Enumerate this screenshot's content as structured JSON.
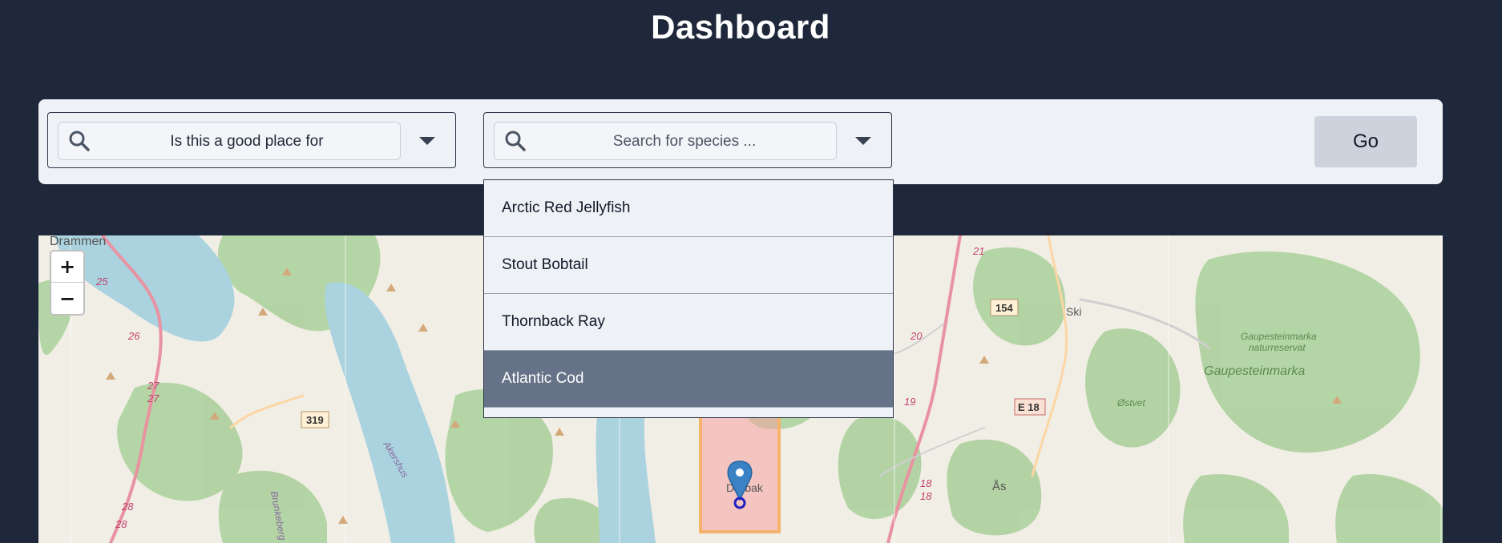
{
  "page": {
    "title": "Dashboard"
  },
  "toolbar": {
    "question_select": {
      "value": "Is this a good place for"
    },
    "species_select": {
      "placeholder": "Search for species ..."
    },
    "go_label": "Go"
  },
  "species_dropdown": {
    "options": [
      "Arctic Red Jellyfish",
      "Stout Bobtail",
      "Thornback Ray",
      "Atlantic Cod"
    ],
    "highlighted": "Atlantic Cod"
  },
  "map": {
    "zoom_in": "+",
    "zoom_out": "−",
    "labels": {
      "drammen": "Drammen",
      "ski": "Ski",
      "as": "Ås",
      "drobak": "Drøbak",
      "gaupesteinmarka": "Gaupesteinmarka",
      "gaupesteinmarka_reserve_1": "Gaupesteinmarka",
      "gaupesteinmarka_reserve_2": "naturreservat",
      "ostvet": "Østvet",
      "akershus": "Akershus",
      "brunkeberg": "Brunkeberg"
    },
    "road_shields": {
      "r319": "319",
      "r154": "154",
      "e18": "E 18",
      "r25": "25",
      "r26": "26",
      "r27a": "27",
      "r27b": "27",
      "r28a": "28",
      "r28b": "28",
      "r21": "21",
      "r20": "20",
      "r19": "19",
      "r18a": "18",
      "r18b": "18"
    },
    "colors": {
      "water": "#aad3df",
      "forest": "#add19e",
      "land": "#f1eee5",
      "highlight": "#f6b26b"
    }
  }
}
